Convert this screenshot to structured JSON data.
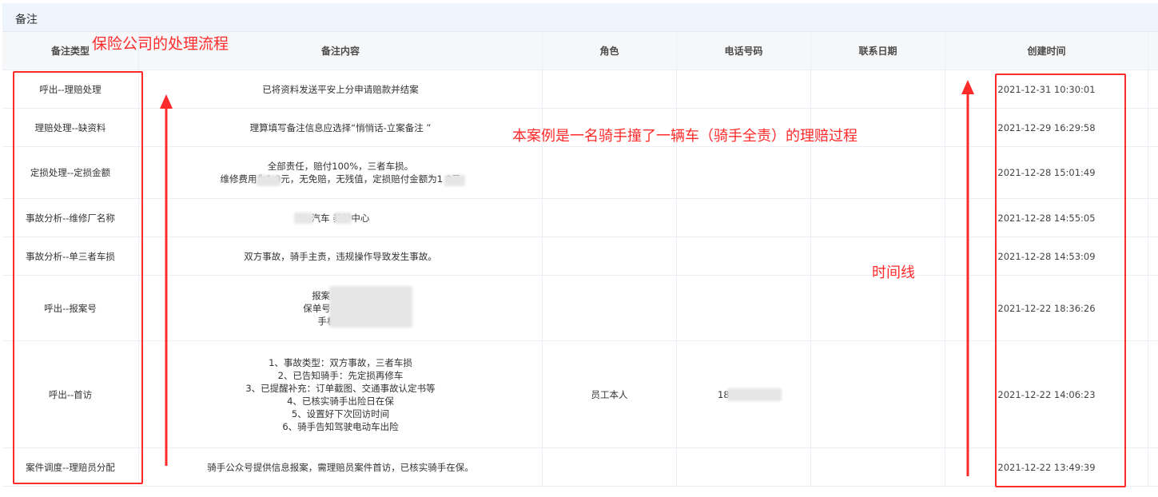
{
  "section": {
    "title": "备注"
  },
  "table": {
    "headers": [
      "备注类型",
      "备注内容",
      "角色",
      "电话号码",
      "联系日期",
      "创建时间"
    ],
    "rows": [
      {
        "type": "呼出--理赔处理",
        "content": [
          "已将资料发送平安上分申请赔款并结案"
        ],
        "role": "",
        "phone": "",
        "contact_date": "",
        "created": "2021-12-31 10:30:01"
      },
      {
        "type": "理赔处理--缺资料",
        "content": [
          "理算填写备注信息应选择“悄悄话-立案备注 ”"
        ],
        "role": "",
        "phone": "",
        "contact_date": "",
        "created": "2021-12-29 16:29:58"
      },
      {
        "type": "定损处理--定损金额",
        "content": [
          "全部责任，赔付100%，三者车损。",
          "维修费用为1  0元，无免赔，无残值，定损赔付金额为1  0元"
        ],
        "role": "",
        "phone": "",
        "contact_date": "",
        "created": "2021-12-28 15:01:49"
      },
      {
        "type": "事故分析--维修厂名称",
        "content": [
          "汽车  养护中心"
        ],
        "role": "",
        "phone": "",
        "contact_date": "",
        "created": "2021-12-28 14:55:05"
      },
      {
        "type": "事故分析--单三者车损",
        "content": [
          "双方事故，骑手主责，违规操作导致发生事故。"
        ],
        "role": "",
        "phone": "",
        "contact_date": "",
        "created": "2021-12-28 14:53:09"
      },
      {
        "type": "呼出--报案号",
        "content": [
          "报案号：90          7",
          "保单号：1024          61",
          "手机号：          1"
        ],
        "role": "",
        "phone": "",
        "contact_date": "",
        "created": "2021-12-22 18:36:26"
      },
      {
        "type": "呼出--首访",
        "content": [
          "1、事故类型：双方事故，三者车损",
          "2、已告知骑手：先定损再修车",
          "3、已提醒补充：订单截图、交通事故认定书等",
          "4、已核实骑手出险日在保",
          "5、设置好下次回访时间",
          "6、骑手告知驾驶电动车出险"
        ],
        "role": "员工本人",
        "phone": "18",
        "contact_date": "",
        "created": "2021-12-22 14:06:23"
      },
      {
        "type": "案件调度--理赔员分配",
        "content": [
          "骑手公众号提供信息报案，需理赔员案件首访，已核实骑手在保。"
        ],
        "role": "",
        "phone": "",
        "contact_date": "",
        "created": "2021-12-22 13:49:39"
      }
    ]
  },
  "annotations": {
    "process_label": "保险公司的处理流程",
    "case_label": "本案例是一名骑手撞了一辆车（骑手全责）的理赔过程",
    "timeline_label": "时间线",
    "color": "#ff2a2a"
  }
}
